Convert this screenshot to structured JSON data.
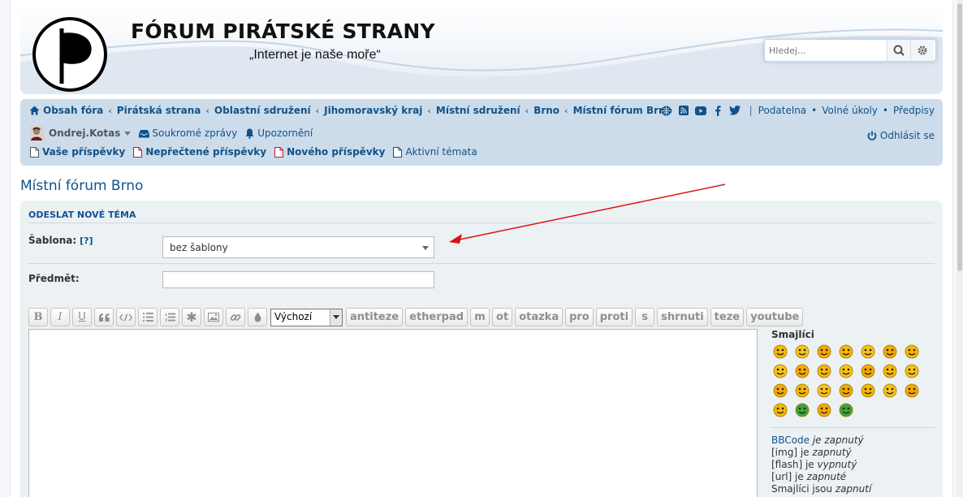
{
  "header": {
    "title": "FÓRUM PIRÁTSKÉ STRANY",
    "slogan": "„Internet je naše moře“",
    "search_placeholder": "Hledej…"
  },
  "breadcrumbs": [
    "Obsah fóra",
    "Pirátská strana",
    "Oblastní sdružení",
    "Jihomoravský kraj",
    "Místní sdružení",
    "Brno",
    "Místní fórum Brno"
  ],
  "nav_links": [
    "Podatelna",
    "Volné úkoly",
    "Předpisy"
  ],
  "social_icons": [
    "globe-icon",
    "rss-icon",
    "youtube-icon",
    "facebook-icon",
    "twitter-icon"
  ],
  "user": {
    "name": "Ondrej.Kotas",
    "messages": "Soukromé zprávy",
    "notifications": "Upozornění",
    "logout": "Odhlásit se"
  },
  "quick_links": [
    "Vaše příspěvky",
    "Nepřečtené příspěvky",
    "Nového příspěvky",
    "Aktivní témata"
  ],
  "page_title": "Místní fórum Brno",
  "form": {
    "heading": "ODESLAT NOVÉ TÉMA",
    "template_label": "Šablona:",
    "template_help": "[?]",
    "template_value": "bez šablony",
    "subject_label": "Předmět:",
    "subject_value": "",
    "font_select": "Výchozí",
    "custom_buttons": [
      "antiteze",
      "etherpad",
      "m",
      "ot",
      "otazka",
      "pro",
      "proti",
      "s",
      "shrnuti",
      "teze",
      "youtube"
    ]
  },
  "smilies": {
    "title": "Smajlíci",
    "count": 25
  },
  "options": {
    "bbcode_link": "BBCode",
    "bbcode_state": "je zapnutý",
    "img": "[img] je",
    "img_state": "zapnutý",
    "flash": "[flash] je",
    "flash_state": "vypnutý",
    "url": "[url] je",
    "url_state": "zapnuté",
    "smilies": "Smajlíci jsou",
    "smilies_state": "zapnutí"
  },
  "colors": {
    "link": "#105289",
    "nav_bg": "#cddceb",
    "panel_bg": "#ecf1f3",
    "arrow": "#dd1111"
  }
}
